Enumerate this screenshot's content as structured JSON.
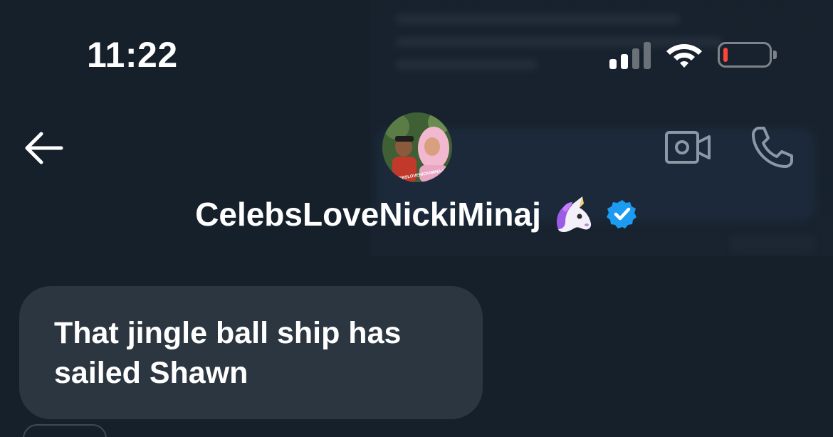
{
  "status_bar": {
    "time": "11:22",
    "signal_icon": "cellular-signal-icon",
    "wifi_icon": "wifi-icon",
    "battery_icon": "battery-low-icon",
    "battery_level": 0.05,
    "battery_color": "#ff453a"
  },
  "header": {
    "back_icon": "arrow-left-icon",
    "avatar_caption": "CELEBSLOVENICKIMINAJ",
    "display_name": "CelebsLoveNickiMinaj",
    "emoji": "🦄",
    "verified_icon": "verified-badge-icon",
    "verified_color": "#1d9bf0",
    "video_icon": "video-camera-icon",
    "call_icon": "phone-icon"
  },
  "messages": [
    {
      "text": "That jingle ball ship has sailed Shawn",
      "direction": "incoming",
      "bubble_color": "#2c3640"
    }
  ],
  "theme": {
    "background": "#15202b",
    "icon_color": "#ffffff",
    "muted_icon_color": "#8b98a5"
  }
}
